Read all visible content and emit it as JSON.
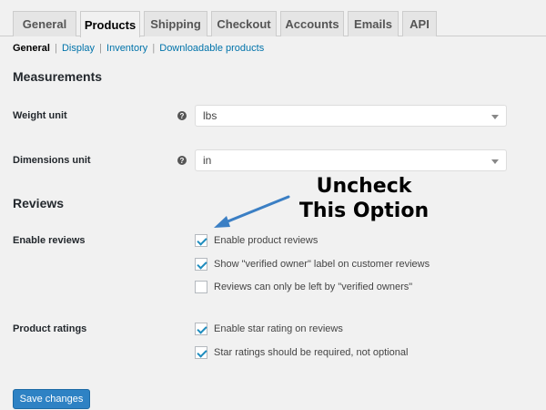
{
  "tabs": [
    "General",
    "Products",
    "Shipping",
    "Checkout",
    "Accounts",
    "Emails",
    "API"
  ],
  "subnav": {
    "current": "General",
    "links": [
      "Display",
      "Inventory",
      "Downloadable products"
    ]
  },
  "measurements": {
    "title": "Measurements",
    "weight": {
      "label": "Weight unit",
      "value": "lbs"
    },
    "dimensions": {
      "label": "Dimensions unit",
      "value": "in"
    }
  },
  "reviews": {
    "title": "Reviews",
    "enable_label": "Enable reviews",
    "options": [
      {
        "label": "Enable product reviews",
        "checked": true
      },
      {
        "label": "Show \"verified owner\" label on customer reviews",
        "checked": true
      },
      {
        "label": "Reviews can only be left by \"verified owners\"",
        "checked": false
      }
    ],
    "ratings_label": "Product ratings",
    "rating_options": [
      {
        "label": "Enable star rating on reviews",
        "checked": true
      },
      {
        "label": "Star ratings should be required, not optional",
        "checked": true
      }
    ]
  },
  "annotation": {
    "line1": "Uncheck",
    "line2": "This Option"
  },
  "save_label": "Save changes",
  "help_glyph": "?",
  "colors": {
    "accent": "#0073aa",
    "button": "#2e82c4",
    "arrow": "#3b7fc4"
  }
}
